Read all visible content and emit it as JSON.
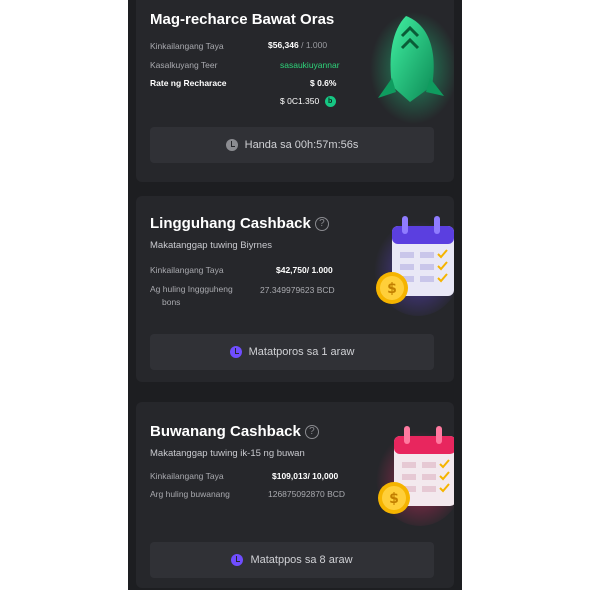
{
  "hourly": {
    "title": "Mag-recharce Bawat Oras",
    "rows": [
      {
        "label": "Kinkailangang Taya",
        "value": "$56,346",
        "suffix": "/ 1.000"
      },
      {
        "label": "Kasalkuyang Teer",
        "value": "sasaukiuyannar"
      },
      {
        "label": "Rate ng Recharace",
        "value": "$ 0.6%"
      }
    ],
    "amount": "$ 0C1.350",
    "coin_symbol": "b",
    "button_label": "Handa sa 00h:57m:56s",
    "colors": {
      "accent": "#16c784"
    }
  },
  "weekly": {
    "title": "Lingguhang Cashback",
    "subtitle": "Makatanggap tuwing Biyrnes",
    "rows": [
      {
        "label": "Kinkailangang Taya",
        "value": "$42,750/ 1.000"
      },
      {
        "label": "Ag huling Inggguheng",
        "label2": "bons",
        "value": "27.349979623 BCD"
      }
    ],
    "button_label": "Matatporos sa 1 araw",
    "colors": {
      "accent": "#6f4dff"
    }
  },
  "monthly": {
    "title": "Buwanang Cashback",
    "subtitle": "Makatanggap tuwing ik-15 ng buwan",
    "rows": [
      {
        "label": "Kinkailangang Taya",
        "value": "$109,013/ 10,000"
      },
      {
        "label": "Arg huling buwanang",
        "value": "126875092870 BCD"
      }
    ],
    "button_label": "Matatppos sa 8 araw",
    "colors": {
      "accent": "#ff2f6e"
    }
  },
  "icons": [
    "rocket-icon",
    "calendar-coin-icon",
    "clock-icon",
    "help-icon"
  ]
}
